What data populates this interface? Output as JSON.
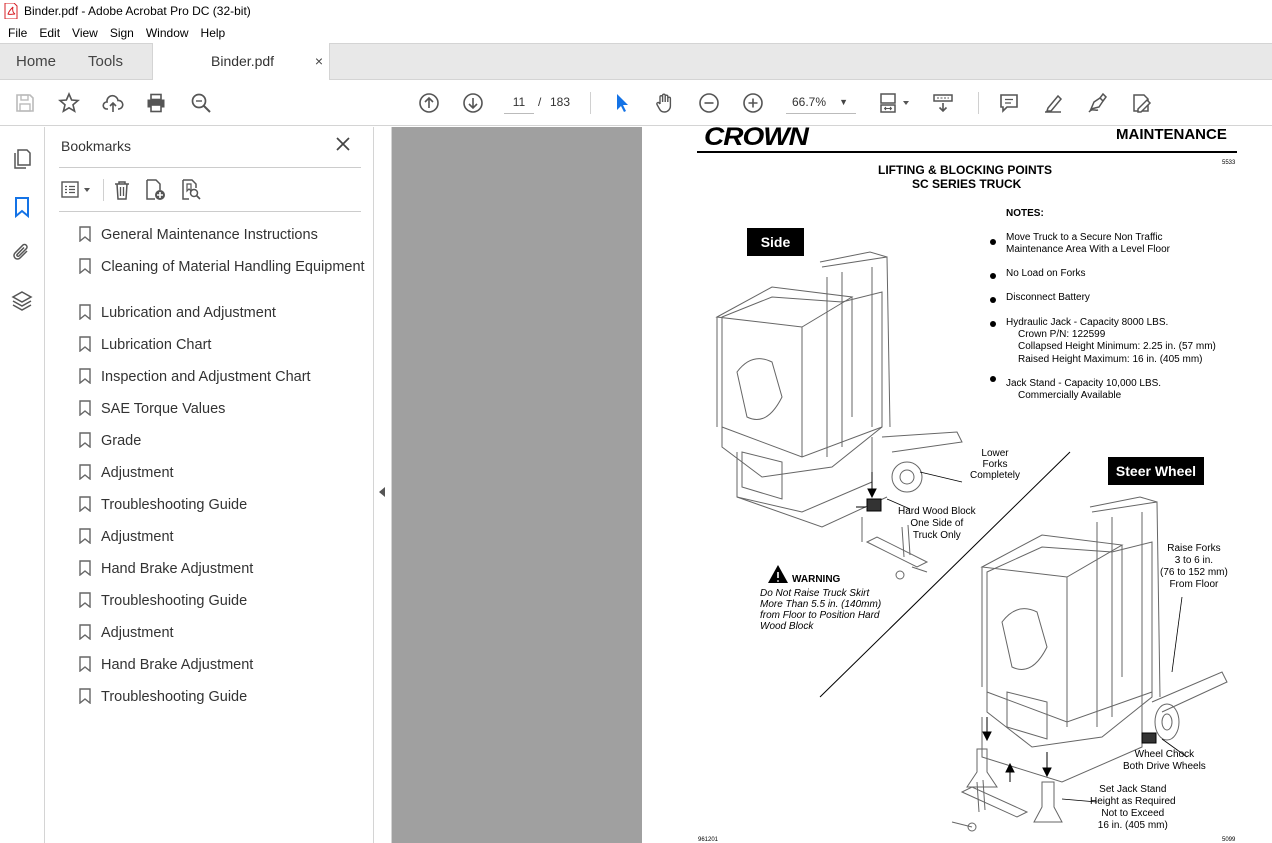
{
  "window": {
    "title": "Binder.pdf - Adobe Acrobat Pro DC (32-bit)"
  },
  "menu": [
    "File",
    "Edit",
    "View",
    "Sign",
    "Window",
    "Help"
  ],
  "tabs": {
    "home": "Home",
    "tools": "Tools",
    "document": "Binder.pdf",
    "close": "×"
  },
  "toolbar": {
    "current_page": "11",
    "page_sep": "/",
    "total_pages": "183",
    "zoom": "66.7%"
  },
  "bookmarks": {
    "title": "Bookmarks",
    "items": [
      "General Maintenance Instructions",
      "Cleaning of Material Handling Equipment",
      "Lubrication and Adjustment",
      "Lubrication Chart",
      "Inspection and Adjustment Chart",
      "SAE Torque Values",
      "Grade",
      "Adjustment",
      "Troubleshooting Guide",
      "Adjustment",
      "Hand Brake Adjustment",
      "Troubleshooting Guide",
      "Adjustment",
      "Hand Brake Adjustment",
      "Troubleshooting Guide"
    ]
  },
  "pdf_page": {
    "logo": "CROWN",
    "header": "MAINTENANCE",
    "code_top": "5533",
    "title_line1": "LIFTING & BLOCKING POINTS",
    "title_line2": "SC SERIES TRUCK",
    "notes_heading": "NOTES:",
    "notes": [
      "Move Truck to a Secure Non Traffic",
      "Maintenance Area With a Level Floor",
      "No Load on Forks",
      "Disconnect Battery",
      "Hydraulic Jack - Capacity 8000 LBS.",
      "Crown P/N: 122599",
      "Collapsed Height Minimum: 2.25 in. (57 mm)",
      "Raised Height Maximum: 16 in. (405 mm)",
      "Jack Stand - Capacity 10,000 LBS.",
      "Commercially Available"
    ],
    "side_label": "Side",
    "steer_label": "Steer Wheel",
    "lower_forks": [
      "Lower",
      "Forks",
      "Completely"
    ],
    "hard_wood": [
      "Hard Wood Block",
      "One Side of",
      "Truck Only"
    ],
    "warning_title": "WARNING",
    "warning_text": [
      "Do Not Raise Truck Skirt",
      "More Than 5.5 in. (140mm)",
      "from Floor to Position Hard",
      "Wood Block"
    ],
    "raise_forks": [
      "Raise Forks",
      "3 to 6 in.",
      "(76 to 152 mm)",
      "From Floor"
    ],
    "wheel_chock": [
      "Wheel Chock",
      "Both Drive Wheels"
    ],
    "jack_stand": [
      "Set Jack Stand",
      "Height as Required",
      "Not to Exceed",
      "16 in. (405 mm)"
    ],
    "code_bottom_left": "961201",
    "code_bottom_right": "5099"
  }
}
